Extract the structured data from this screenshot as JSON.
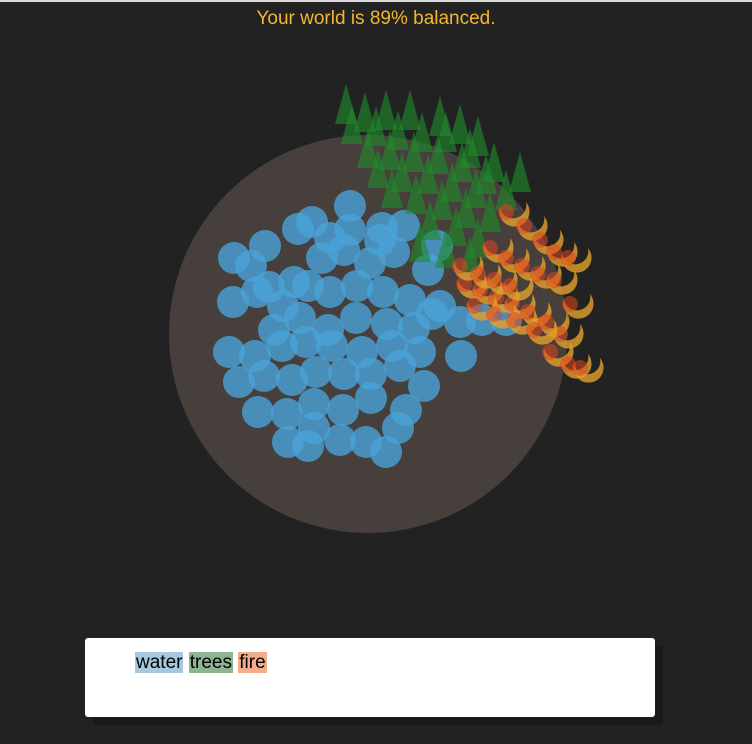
{
  "status": {
    "text": "Your world is 89% balanced.",
    "balance_percent": 89
  },
  "colors": {
    "background": "#222222",
    "status_text": "#f2b632",
    "planet": "#463f3c",
    "water": "#4aa3d8",
    "trees": "#1f8a2a",
    "fire_outer": "#e3a12e",
    "fire_inner": "#e0431d",
    "highlight_water": "#a7c8e1",
    "highlight_trees": "#8db591",
    "highlight_fire": "#f3ad8b"
  },
  "editor": {
    "words": [
      {
        "key": "water",
        "text": "water"
      },
      {
        "key": "trees",
        "text": "trees"
      },
      {
        "key": "fire",
        "text": "fire"
      }
    ]
  }
}
